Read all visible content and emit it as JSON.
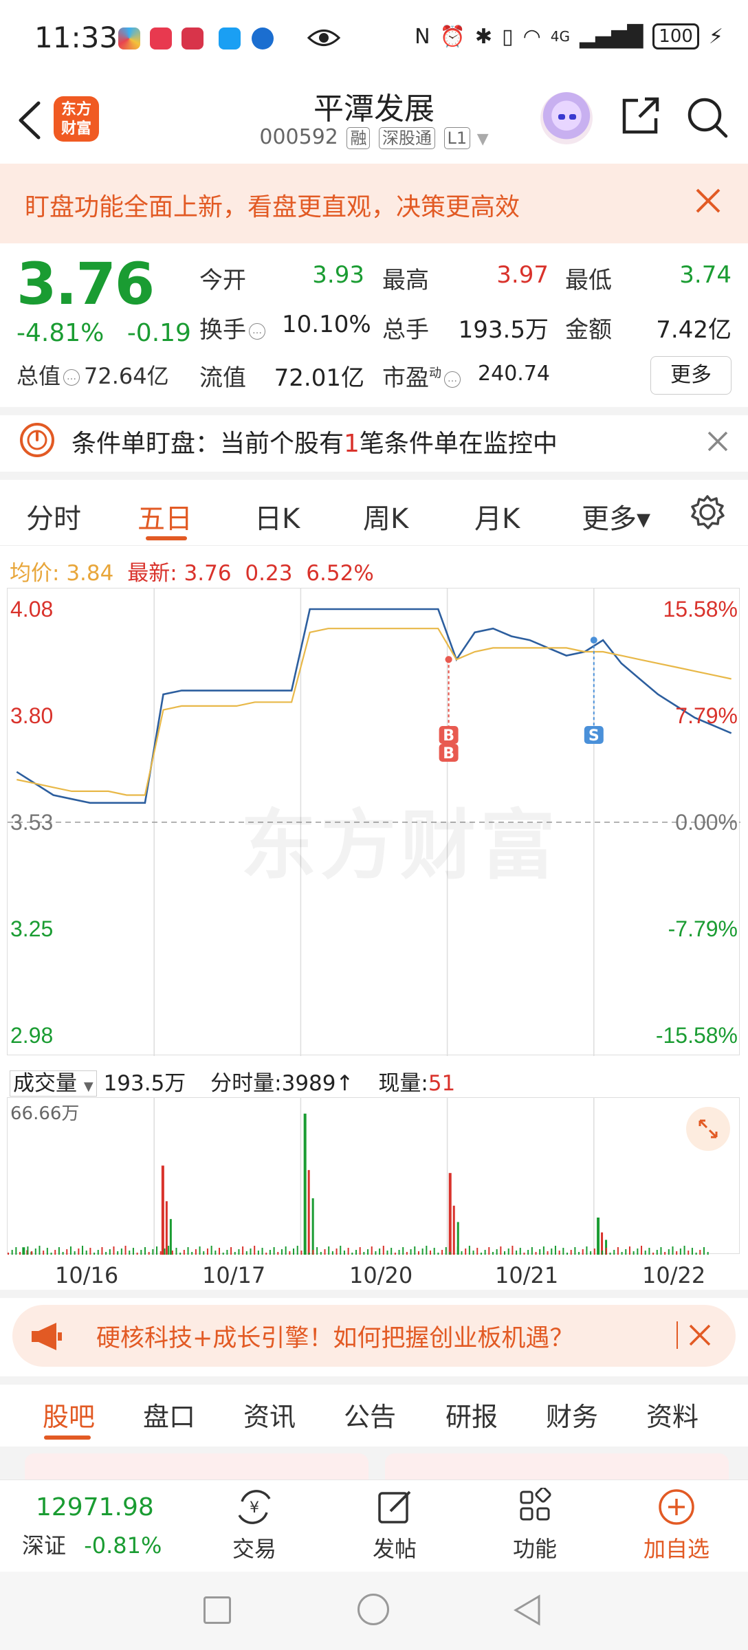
{
  "status_bar": {
    "time": "11:33",
    "network": "4G",
    "battery": "100"
  },
  "header": {
    "brand_logo": "东方\n财富",
    "stock_name": "平潭发展",
    "stock_code": "000592",
    "tags": [
      "融",
      "深股通",
      "L1"
    ]
  },
  "promo": {
    "text": "盯盘功能全面上新，看盘更直观，决策更高效"
  },
  "quote": {
    "price": "3.76",
    "change_pct": "-4.81%",
    "change_amt": "-0.19",
    "total_cap_label": "总值",
    "total_cap_value": "72.64亿",
    "open_label": "今开",
    "open_value": "3.93",
    "high_label": "最高",
    "high_value": "3.97",
    "low_label": "最低",
    "low_value": "3.74",
    "turnover_label": "换手",
    "turnover_value": "10.10%",
    "volume_label": "总手",
    "volume_value": "193.5万",
    "amount_label": "金额",
    "amount_value": "7.42亿",
    "float_label": "流值",
    "float_value": "72.01亿",
    "pe_label": "市盈",
    "pe_sup": "动",
    "pe_value": "240.74",
    "more_label": "更多"
  },
  "condition": {
    "prefix": "条件单盯盘：当前个股有",
    "count": "1",
    "suffix": "笔条件单在监控中"
  },
  "chart_tabs": [
    {
      "label": "分时",
      "active": false
    },
    {
      "label": "五日",
      "active": true
    },
    {
      "label": "日K",
      "active": false
    },
    {
      "label": "周K",
      "active": false
    },
    {
      "label": "月K",
      "active": false
    },
    {
      "label": "更多▾",
      "active": false
    }
  ],
  "avg_row": {
    "avg_label": "均价:",
    "avg_value": "3.84",
    "latest_label": "最新:",
    "latest_value": "3.76",
    "latest_chg": "0.23",
    "latest_pct": "6.52%"
  },
  "chart_data": {
    "type": "line",
    "title": "",
    "y_left_ticks": [
      "4.08",
      "3.80",
      "3.53",
      "3.25",
      "2.98"
    ],
    "y_right_ticks": [
      "15.58%",
      "7.79%",
      "0.00%",
      "-7.79%",
      "-15.58%"
    ],
    "ylim": [
      2.98,
      4.08
    ],
    "prev_close": 3.53,
    "x_days": [
      "10/16",
      "10/17",
      "10/20",
      "10/21",
      "10/22"
    ],
    "series": [
      {
        "name": "",
        "color": "#2c5e9e",
        "values": [
          [
            3.66,
            3.63,
            3.6,
            3.59,
            3.58,
            3.58,
            3.58,
            3.58
          ],
          [
            3.86,
            3.87,
            3.87,
            3.87,
            3.87,
            3.87,
            3.87,
            3.87
          ],
          [
            4.08,
            4.08,
            4.08,
            4.08,
            4.08,
            4.08,
            4.08,
            4.08
          ],
          [
            3.95,
            4.02,
            4.03,
            4.01,
            4.0,
            3.98,
            3.96,
            3.97
          ],
          [
            4.0,
            3.94,
            3.9,
            3.86,
            3.83,
            3.8,
            3.78,
            3.76
          ]
        ]
      },
      {
        "name": "",
        "color": "#e8b848",
        "values": [
          [
            3.64,
            3.63,
            3.62,
            3.61,
            3.61,
            3.61,
            3.6,
            3.6
          ],
          [
            3.82,
            3.83,
            3.83,
            3.83,
            3.83,
            3.84,
            3.84,
            3.84
          ],
          [
            4.02,
            4.03,
            4.03,
            4.03,
            4.03,
            4.03,
            4.03,
            4.03
          ],
          [
            3.95,
            3.97,
            3.98,
            3.98,
            3.98,
            3.98,
            3.98,
            3.97
          ],
          [
            3.97,
            3.96,
            3.95,
            3.94,
            3.93,
            3.92,
            3.91,
            3.9
          ]
        ]
      }
    ],
    "markers": [
      {
        "label": "B",
        "day": 3,
        "color": "#e85a50"
      },
      {
        "label": "B",
        "day": 3,
        "color": "#e85a50"
      },
      {
        "label": "S",
        "day": 4,
        "color": "#4a90d9"
      }
    ],
    "volume": {
      "label": "成交量",
      "total": "193.5万",
      "tick_label": "分时量:3989",
      "current_label": "现量:",
      "current_value": "51",
      "ymax_label": "66.66万"
    }
  },
  "ad": {
    "text": "硬核科技+成长引擎！如何把握创业板机遇？"
  },
  "bottom_tabs": [
    {
      "label": "股吧",
      "active": true
    },
    {
      "label": "盘口",
      "active": false
    },
    {
      "label": "资讯",
      "active": false
    },
    {
      "label": "公告",
      "active": false
    },
    {
      "label": "研报",
      "active": false
    },
    {
      "label": "财务",
      "active": false
    },
    {
      "label": "资料",
      "active": false
    }
  ],
  "bottom_bar": {
    "index_value": "12971.98",
    "index_name": "深证",
    "index_pct": "-0.81%",
    "trade": "交易",
    "post": "发帖",
    "function": "功能",
    "add_watch": "加自选"
  },
  "colors": {
    "accent": "#e25a24",
    "up": "#d9322b",
    "down": "#1a9c32"
  }
}
